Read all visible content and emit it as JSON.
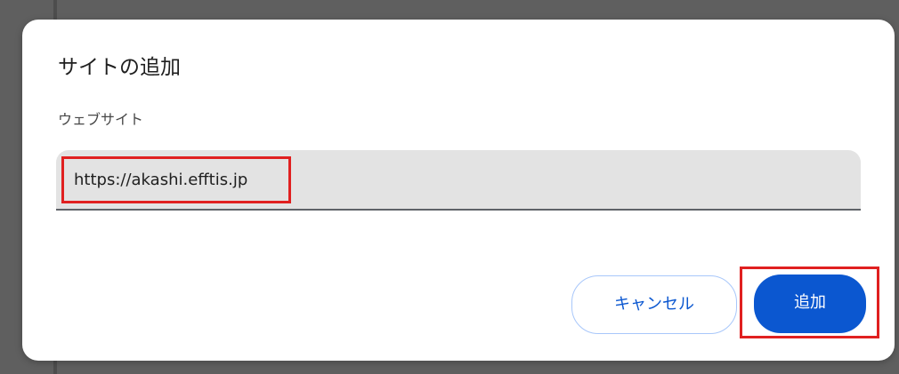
{
  "dialog": {
    "title": "サイトの追加",
    "field_label": "ウェブサイト",
    "website_input": {
      "value": "https://akashi.efftis.jp",
      "placeholder": ""
    },
    "buttons": {
      "cancel_label": "キャンセル",
      "add_label": "追加"
    }
  },
  "colors": {
    "primary": "#0b57d0",
    "highlight": "#e02020",
    "input_background": "#e3e3e3",
    "backdrop": "#5f5f5f"
  }
}
